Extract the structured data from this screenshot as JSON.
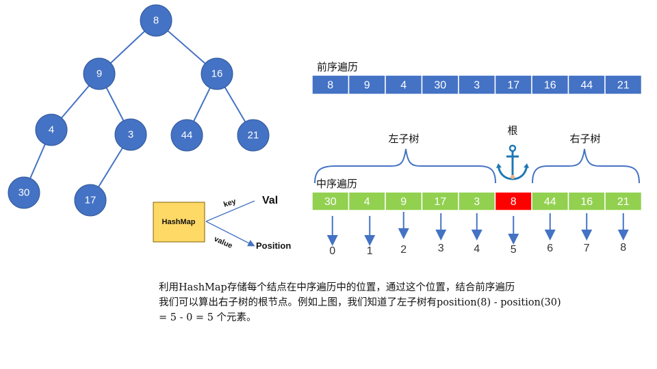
{
  "tree": {
    "nodes": [
      "8",
      "9",
      "16",
      "4",
      "3",
      "44",
      "21",
      "30",
      "17"
    ],
    "edges": [
      [
        0,
        1
      ],
      [
        0,
        2
      ],
      [
        1,
        3
      ],
      [
        1,
        4
      ],
      [
        2,
        5
      ],
      [
        2,
        6
      ],
      [
        3,
        7
      ],
      [
        4,
        8
      ]
    ],
    "colors": {
      "fill": "#4472C4",
      "stroke": "#2F5597",
      "edge": "#4472C4"
    }
  },
  "preorder": {
    "title": "前序遍历",
    "values": [
      "8",
      "9",
      "4",
      "30",
      "3",
      "17",
      "16",
      "44",
      "21"
    ],
    "color": "#4472C4"
  },
  "inorder": {
    "title": "中序遍历",
    "values": [
      "30",
      "4",
      "9",
      "17",
      "3",
      "8",
      "44",
      "16",
      "21"
    ],
    "indices": [
      "0",
      "1",
      "2",
      "3",
      "4",
      "5",
      "6",
      "7",
      "8"
    ],
    "root_index": 5,
    "color": "#92D050",
    "root_color": "#FF0000",
    "left_label": "左子树",
    "root_label": "根",
    "right_label": "右子树"
  },
  "hashmap": {
    "label": "HashMap",
    "key_label": "key",
    "value_label": "value",
    "key_target": "Val",
    "value_target": "Position",
    "color": "#FFD966"
  },
  "caption": {
    "line1": "利用HashMap存储每个结点在中序遍历中的位置，通过这个位置，结合前序遍历",
    "line2": "我们可以算出右子树的根节点。例如上图，我们知道了左子树有position(8) - position(30)",
    "line3": "= 5 - 0 = 5 个元素。"
  },
  "icons": [
    "anchor-icon"
  ]
}
